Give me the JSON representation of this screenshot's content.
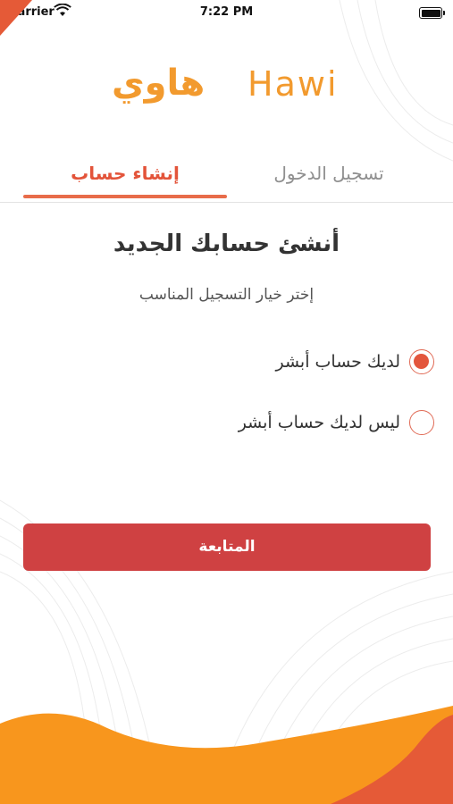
{
  "status_bar": {
    "carrier": "Carrier",
    "time": "7:22 PM"
  },
  "logo": {
    "arabic_text": "هاوي",
    "english_text": "Hawi"
  },
  "tabs": [
    {
      "label": "إنشاء حساب",
      "active": true
    },
    {
      "label": "تسجيل الدخول",
      "active": false
    }
  ],
  "heading": "أنشئ حسابك الجديد",
  "subheading": "إختر خيار التسجيل المناسب",
  "options": [
    {
      "label": "لديك حساب أبشر",
      "selected": true
    },
    {
      "label": "ليس لديك حساب أبشر",
      "selected": false
    }
  ],
  "continue_button": "المتابعة",
  "colors": {
    "accent": "#e3563d",
    "button": "#cf4142",
    "logo": "#f29a2e",
    "wave_orange": "#f8961d",
    "wave_red": "#e55a37"
  }
}
